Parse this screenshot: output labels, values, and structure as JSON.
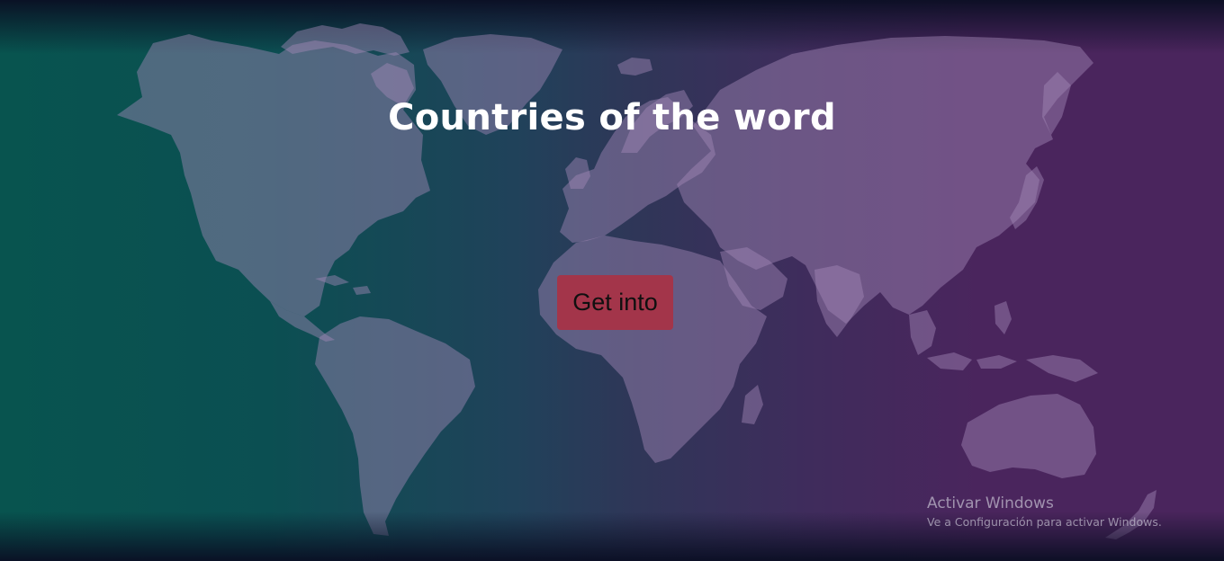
{
  "page": {
    "title": "Countries of the word",
    "background_colors": [
      "#08544f",
      "#4a255d"
    ]
  },
  "actions": {
    "enter_label": "Get into",
    "enter_color": "#a3354a"
  },
  "background_image": {
    "icon": "world-map"
  },
  "windows_watermark": {
    "title": "Activar Windows",
    "subtitle": "Ve a Configuración para activar Windows."
  }
}
